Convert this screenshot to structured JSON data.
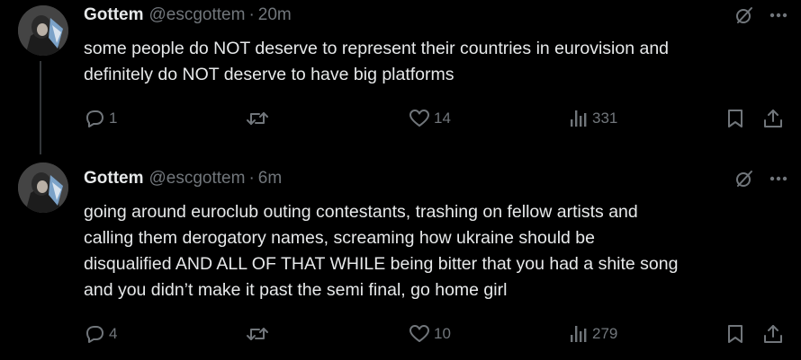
{
  "tweets": [
    {
      "author_name": "Gottem",
      "handle": "@escgottem",
      "separator": "·",
      "time": "20m",
      "text_lines": [
        "some people do NOT deserve to represent their countries in eurovision and",
        "definitely do NOT deserve to have big platforms"
      ],
      "replies": "1",
      "reposts": "",
      "likes": "14",
      "views": "331"
    },
    {
      "author_name": "Gottem",
      "handle": "@escgottem",
      "separator": "·",
      "time": "6m",
      "text_lines": [
        "going around euroclub outing contestants, trashing on fellow artists and",
        "calling them derogatory names, screaming how ukraine should be",
        "disqualified AND ALL OF THAT WHILE being bitter that you had a shite song",
        "and you didn’t make it past the semi final, go home girl"
      ],
      "replies": "4",
      "reposts": "",
      "likes": "10",
      "views": "279"
    }
  ],
  "icons": {
    "reply": "reply-icon",
    "repost": "repost-icon",
    "like": "heart-icon",
    "views": "views-icon",
    "bookmark": "bookmark-icon",
    "share": "share-icon",
    "grok": "grok-icon",
    "more": "more-icon"
  },
  "colors": {
    "background": "#000000",
    "text_primary": "#e7e9ea",
    "text_secondary": "#71767b",
    "thread_line": "#333639"
  }
}
